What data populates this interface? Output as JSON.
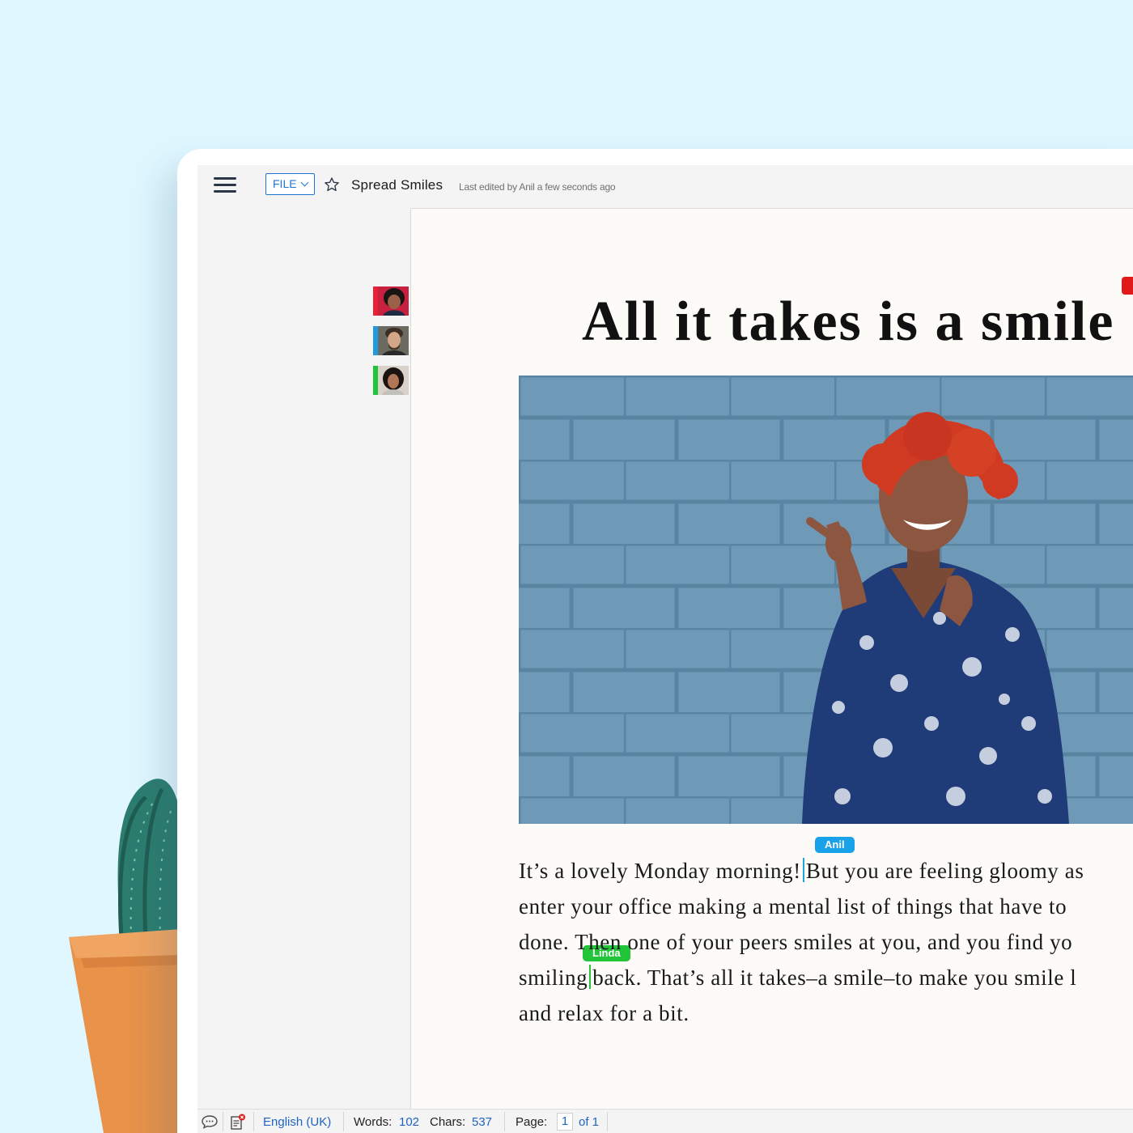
{
  "header": {
    "file_label": "FILE",
    "doc_title": "Spread Smiles",
    "last_edited": "Last edited by Anil a few seconds ago"
  },
  "collaborators": [
    {
      "color": "#e8203a"
    },
    {
      "color": "#1e9be0"
    },
    {
      "color": "#1fc43b"
    }
  ],
  "document": {
    "heading": "All it takes is a smile",
    "cursors": {
      "anil": "Anil",
      "linda": "Linda"
    },
    "lines": [
      {
        "a": "It’s a lovely Monday morning!",
        "b": "But you are feeling gloomy as"
      },
      {
        "text": "enter your office making a mental list of things that have to"
      },
      {
        "text": "done. Then one of your peers smiles at you, and you find yo"
      },
      {
        "a": "smiling",
        "b": "back. That’s all it takes–a smile–to make you smile l"
      },
      {
        "text": "and relax for a bit."
      }
    ]
  },
  "statusbar": {
    "language": "English (UK)",
    "words_label": "Words:",
    "words": "102",
    "chars_label": "Chars:",
    "chars": "537",
    "page_label": "Page:",
    "page_current": "1",
    "page_total": "of 1"
  },
  "colors": {
    "background": "#e0f7ff",
    "accent": "#1f75d0",
    "anil": "#19a2ea",
    "linda": "#22c43a"
  }
}
